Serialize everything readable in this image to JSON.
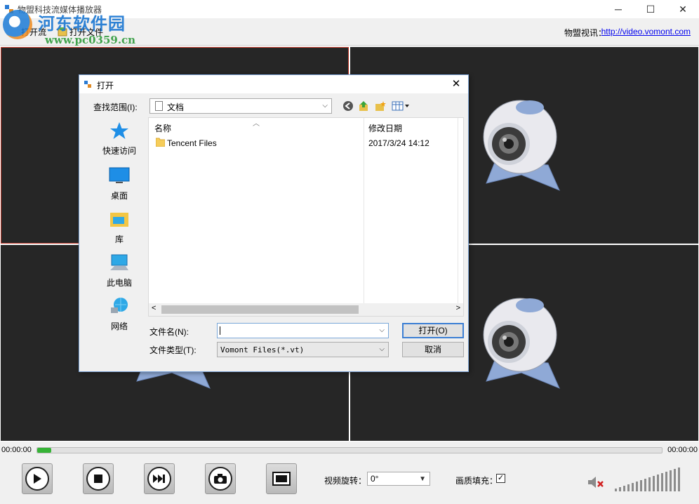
{
  "window": {
    "title": "物盟科技流媒体播放器",
    "minimize_glyph": "─",
    "maximize_glyph": "☐",
    "close_glyph": "✕"
  },
  "toolbar": {
    "open_stream_label": "打开流",
    "open_file_label": "打开文件",
    "brand_label": "物盟视讯：",
    "brand_link": "http://video.vomont.com"
  },
  "watermark": {
    "title": "河东软件园",
    "url": "www.pc0359.cn"
  },
  "player": {
    "time_elapsed": "00:00:00",
    "time_total": "00:00:00",
    "rotation_label": "视频旋转：",
    "rotation_value": "0°",
    "fill_label": "画质填充：",
    "fill_checked": true,
    "muted": true,
    "buttons": [
      "play-icon",
      "stop-icon",
      "next-frame-icon",
      "snapshot-icon",
      "record-icon"
    ]
  },
  "dialog": {
    "title": "打开",
    "look_in_label": "查找范围(I):",
    "look_in_value": "文档",
    "places": [
      {
        "label": "快速访问",
        "icon": "star-icon"
      },
      {
        "label": "桌面",
        "icon": "desktop-icon"
      },
      {
        "label": "库",
        "icon": "library-icon"
      },
      {
        "label": "此电脑",
        "icon": "computer-icon"
      },
      {
        "label": "网络",
        "icon": "network-icon"
      }
    ],
    "columns": {
      "name": "名称",
      "date": "修改日期"
    },
    "files": [
      {
        "name": "Tencent Files",
        "date": "2017/3/24 14:12",
        "type": "folder"
      }
    ],
    "file_name_label": "文件名(N):",
    "file_name_value": "",
    "file_type_label": "文件类型(T):",
    "file_type_value": "Vomont Files(*.vt)",
    "open_button": "打开(O)",
    "cancel_button": "取消"
  },
  "colors": {
    "video_bg": "#262626",
    "selected_pane_border": "#c0392b",
    "progress_fill": "#36b336",
    "link": "#0000ee"
  }
}
